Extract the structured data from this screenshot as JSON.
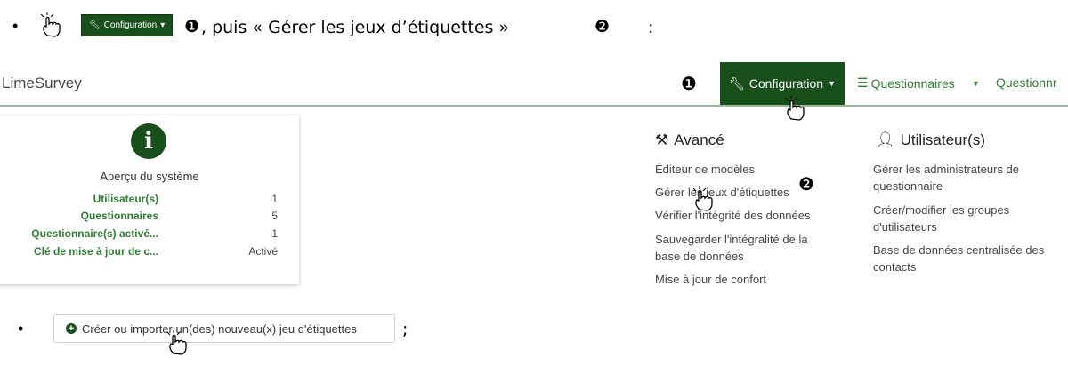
{
  "instruction": {
    "bullet": "•",
    "config_chip_label": "Configuration",
    "step1": "❶",
    "text": ", puis « Gérer les jeux d’étiquettes »",
    "step2": "❷",
    "colon": ":"
  },
  "navbar": {
    "brand": "LimeSurvey",
    "marker": "❶",
    "configuration_label": "Configuration",
    "questionnaires_label": "Questionnaires",
    "questionnaire_cut_label": "Questionnr"
  },
  "system_card": {
    "title": "Aperçu du système",
    "rows": [
      {
        "label": "Utilisateur(s)",
        "value": "1"
      },
      {
        "label": "Questionnaires",
        "value": "5"
      },
      {
        "label": "Questionnaire(s) activé...",
        "value": "1"
      },
      {
        "label": "Clé de mise à jour de c...",
        "value": "Activé"
      }
    ]
  },
  "dropdown": {
    "advanced": {
      "heading": "Avancé",
      "items": [
        "Éditeur de modèles",
        "Gérer les jeux d'étiquettes",
        "Vérifier l'intégrité des données",
        "Sauvegarder l'intégralité de la base de données",
        "Mise à jour de confort"
      ],
      "marker": "❷"
    },
    "users": {
      "heading": "Utilisateur(s)",
      "items": [
        "Gérer les administrateurs de questionnaire",
        "Créer/modifier les groupes d'utilisateurs",
        "Base de données centralisée des contacts"
      ]
    }
  },
  "bottom": {
    "bullet": "•",
    "create_button_label": "Créer ou importer un(des) nouveau(x) jeu d'étiquettes",
    "semicolon": ";"
  },
  "colors": {
    "brand_green": "#184f1b",
    "link_green": "#2e7d32"
  }
}
